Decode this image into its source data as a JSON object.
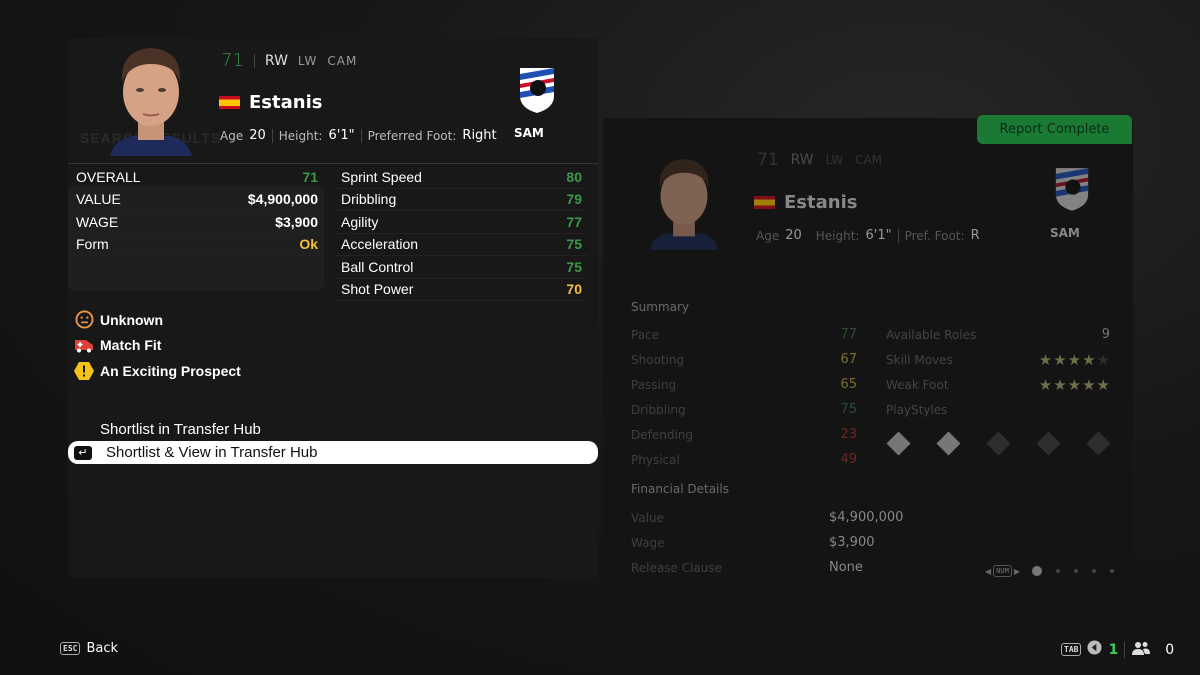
{
  "player": {
    "overall": "71",
    "primary_position": "RW",
    "alt_positions": [
      "LW",
      "CAM"
    ],
    "name": "Estanis",
    "nationality": "Spain",
    "age_label": "Age",
    "age": "20",
    "height_label": "Height:",
    "height": "6'1\"",
    "foot_label": "Preferred Foot:",
    "foot": "Right",
    "club_code": "SAM"
  },
  "ghost_text": "SEARCH RESULTS",
  "stats_left": [
    {
      "label": "OVERALL",
      "value": "71",
      "color": "green"
    },
    {
      "label": "VALUE",
      "value": "$4,900,000",
      "color": "white"
    },
    {
      "label": "WAGE",
      "value": "$3,900",
      "color": "white"
    },
    {
      "label": "Form",
      "value": "Ok",
      "color": "yellow"
    }
  ],
  "stats_right": [
    {
      "label": "Sprint Speed",
      "value": "80"
    },
    {
      "label": "Dribbling",
      "value": "79"
    },
    {
      "label": "Agility",
      "value": "77"
    },
    {
      "label": "Acceleration",
      "value": "75"
    },
    {
      "label": "Ball Control",
      "value": "75"
    },
    {
      "label": "Shot Power",
      "value": "70"
    }
  ],
  "status": [
    {
      "icon": "neutral-face-icon",
      "label": "Unknown"
    },
    {
      "icon": "ambulance-icon",
      "label": "Match Fit"
    },
    {
      "icon": "warning-hexagon-icon",
      "label": "An Exciting Prospect"
    }
  ],
  "menu": [
    {
      "label": "Shortlist in Transfer Hub",
      "active": false
    },
    {
      "label": "Shortlist & View in Transfer Hub",
      "active": true
    }
  ],
  "report": {
    "badge": "Report Complete",
    "overall": "71",
    "positions": [
      "RW",
      "LW",
      "CAM"
    ],
    "name": "Estanis",
    "age_label": "Age",
    "age": "20",
    "height_label": "Height:",
    "height": "6'1\"",
    "foot_label": "Pref. Foot:",
    "foot": "R",
    "club_code": "SAM",
    "summary_title": "Summary",
    "summary": [
      {
        "label": "Pace",
        "value": "77"
      },
      {
        "label": "Shooting",
        "value": "67"
      },
      {
        "label": "Passing",
        "value": "65"
      },
      {
        "label": "Dribbling",
        "value": "75"
      },
      {
        "label": "Defending",
        "value": "23"
      },
      {
        "label": "Physical",
        "value": "49"
      }
    ],
    "available_roles_label": "Available Roles",
    "available_roles": "9",
    "skill_moves_label": "Skill Moves",
    "skill_moves": 4,
    "weak_foot_label": "Weak Foot",
    "weak_foot": 5,
    "playstyles_label": "PlayStyles",
    "playstyles_filled": 2,
    "playstyles_total": 5,
    "financial_title": "Financial Details",
    "financial": [
      {
        "label": "Value",
        "value": "$4,900,000"
      },
      {
        "label": "Wage",
        "value": "$3,900"
      },
      {
        "label": "Release Clause",
        "value": "None"
      }
    ],
    "pager_key": "NUM",
    "pager_current": 1,
    "pager_total": 5
  },
  "footer": {
    "back_key": "ESC",
    "back_label": "Back",
    "tab_key": "TAB",
    "count_green": "1",
    "count_users": "0"
  }
}
